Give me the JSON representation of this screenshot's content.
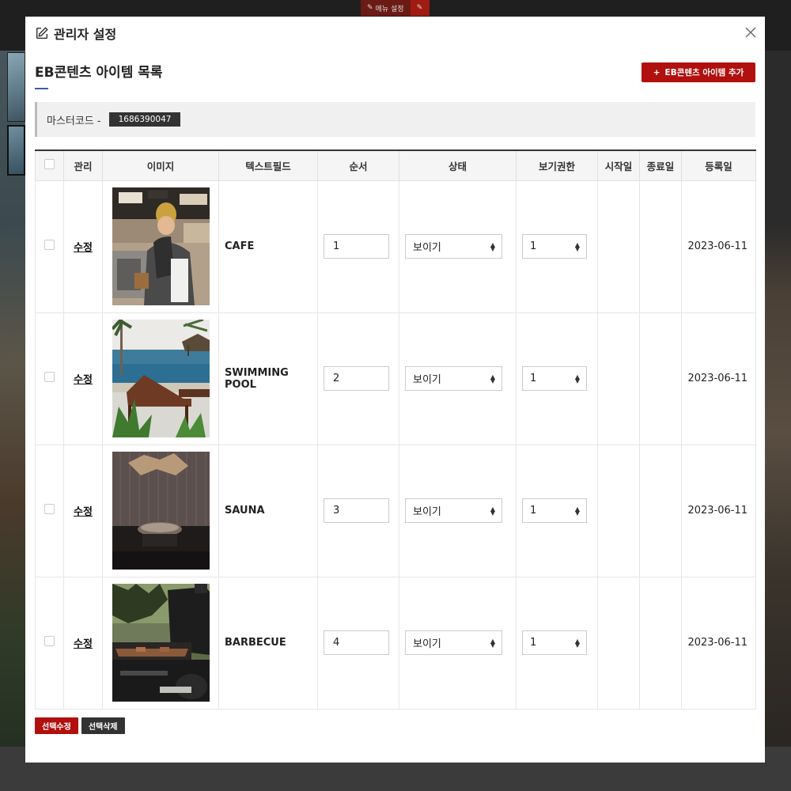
{
  "background": {
    "menu_label": "메뉴 설정"
  },
  "modal": {
    "title": "관리자 설정",
    "section_title": "EB콘텐츠 아이템 목록",
    "add_button_label": "EB콘텐츠 아이템 추가",
    "master_label": "마스터코드 -",
    "master_code": "1686390047"
  },
  "table": {
    "headers": [
      "관리",
      "이미지",
      "텍스트필드",
      "순서",
      "상태",
      "보기권한",
      "시작일",
      "종료일",
      "등록일"
    ],
    "rows": [
      {
        "edit": "수정",
        "image": "cafe-barista-photo",
        "text": "CAFE",
        "order": "1",
        "status": "보이기",
        "permission": "1",
        "start": "",
        "end": "",
        "date": "2023-06-11"
      },
      {
        "edit": "수정",
        "image": "swimming-pool-photo",
        "text": "SWIMMING POOL",
        "order": "2",
        "status": "보이기",
        "permission": "1",
        "start": "",
        "end": "",
        "date": "2023-06-11"
      },
      {
        "edit": "수정",
        "image": "sauna-photo",
        "text": "SAUNA",
        "order": "3",
        "status": "보이기",
        "permission": "1",
        "start": "",
        "end": "",
        "date": "2023-06-11"
      },
      {
        "edit": "수정",
        "image": "barbecue-grill-photo",
        "text": "BARBECUE",
        "order": "4",
        "status": "보이기",
        "permission": "1",
        "start": "",
        "end": "",
        "date": "2023-06-11"
      }
    ]
  },
  "footer": {
    "edit_selected": "선택수정",
    "delete_selected": "선택삭제"
  },
  "colors": {
    "accent_red": "#b20f0f",
    "dark": "#333333",
    "underline_blue": "#3b5ab0"
  }
}
